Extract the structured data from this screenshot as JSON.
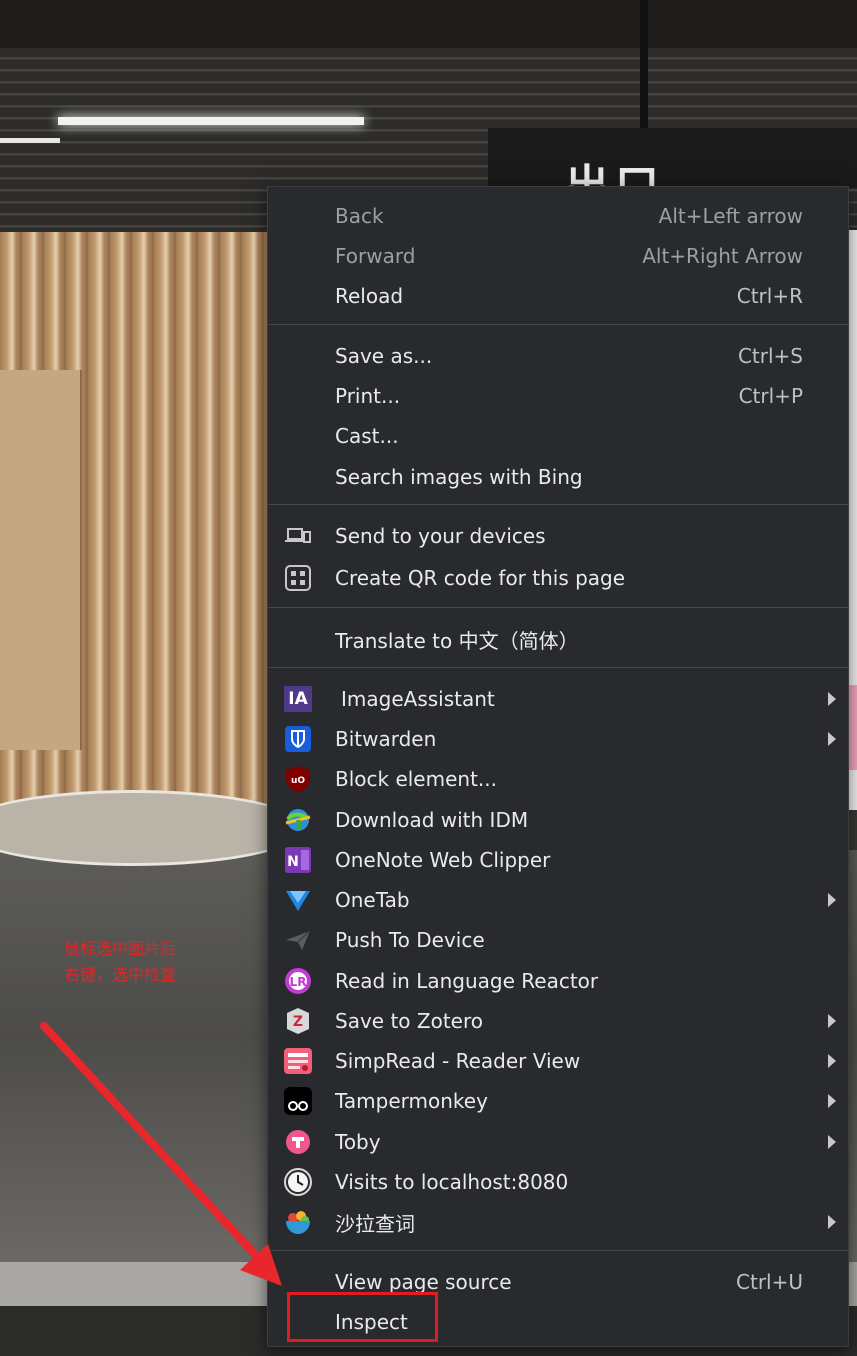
{
  "background": {
    "sign_text": "出口",
    "annotation_lines": [
      "鼠标选中图片后",
      "右键，选中检查"
    ],
    "annotation_color": "#e0262a"
  },
  "menu": {
    "nav": [
      {
        "label": "Back",
        "shortcut": "Alt+Left arrow",
        "disabled": true
      },
      {
        "label": "Forward",
        "shortcut": "Alt+Right Arrow",
        "disabled": true
      },
      {
        "label": "Reload",
        "shortcut": "Ctrl+R",
        "disabled": false
      }
    ],
    "page": [
      {
        "label": "Save as...",
        "shortcut": "Ctrl+S"
      },
      {
        "label": "Print...",
        "shortcut": "Ctrl+P"
      },
      {
        "label": "Cast...",
        "shortcut": ""
      },
      {
        "label": "Search images with Bing",
        "shortcut": ""
      }
    ],
    "share": [
      {
        "label": "Send to your devices",
        "icon": "laptop-phone-icon"
      },
      {
        "label": "Create QR code for this page",
        "icon": "qr-code-icon"
      }
    ],
    "translate": {
      "label": "Translate to 中文（简体）"
    },
    "extensions": [
      {
        "label": "ImageAssistant",
        "icon": "imageassistant-icon",
        "submenu": true
      },
      {
        "label": "Bitwarden",
        "icon": "bitwarden-icon",
        "submenu": true
      },
      {
        "label": "Block element...",
        "icon": "ublock-icon",
        "submenu": false
      },
      {
        "label": "Download with IDM",
        "icon": "idm-globe-icon",
        "submenu": false
      },
      {
        "label": "OneNote Web Clipper",
        "icon": "onenote-icon",
        "submenu": false
      },
      {
        "label": "OneTab",
        "icon": "onetab-funnel-icon",
        "submenu": true
      },
      {
        "label": "Push To Device",
        "icon": "paper-plane-icon",
        "submenu": false
      },
      {
        "label": "Read in Language Reactor",
        "icon": "language-reactor-icon",
        "submenu": false
      },
      {
        "label": "Save to Zotero",
        "icon": "zotero-icon",
        "submenu": true
      },
      {
        "label": "SimpRead - Reader View",
        "icon": "simpread-icon",
        "submenu": true
      },
      {
        "label": "Tampermonkey",
        "icon": "tampermonkey-icon",
        "submenu": true
      },
      {
        "label": "Toby",
        "icon": "toby-icon",
        "submenu": true
      },
      {
        "label": "Visits to localhost:8080",
        "icon": "clock-icon",
        "submenu": false
      },
      {
        "label": "沙拉查词",
        "icon": "salad-bowl-icon",
        "submenu": true
      }
    ],
    "dev": [
      {
        "label": "View page source",
        "shortcut": "Ctrl+U"
      },
      {
        "label": "Inspect",
        "shortcut": ""
      }
    ],
    "ia_icon_text": "IA",
    "highlight_color": "#e01b22"
  }
}
